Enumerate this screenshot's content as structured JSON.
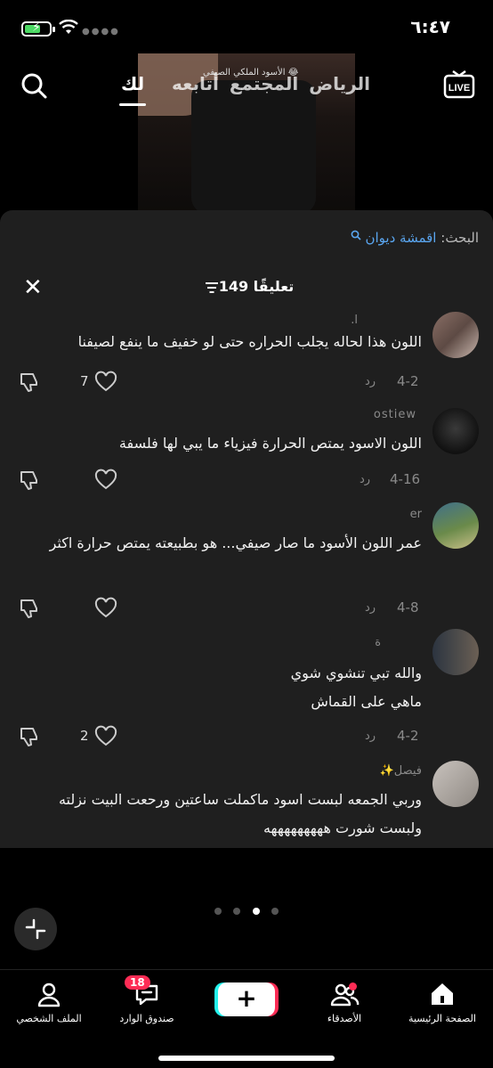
{
  "status_bar": {
    "time": "٦:٤٧"
  },
  "video": {
    "caption": "الأسود الملكي الصيفي 😂"
  },
  "top_nav": {
    "tabs": [
      "الرياض",
      "المجتمع",
      "أتابعه"
    ],
    "active_tab": "لك"
  },
  "sheet": {
    "search_label": "البحث:",
    "search_query": "اقمشة ديوان",
    "comment_count_title": "149 تعليقًا",
    "reply_label": "رد",
    "comments": [
      {
        "name": "ا.",
        "text": "اللون هذا لحاله يجلب الحراره حتى لو خفيف ما ينفع لصيفنا",
        "date": "4-2",
        "likes": "7"
      },
      {
        "name": "ostiew",
        "text": "اللون الاسود يمتص الحرارة فيزياء ما يبي لها فلسفة",
        "date": "4-16",
        "likes": ""
      },
      {
        "name": "er",
        "text": "عمر اللون الأسود ما صار صيفي... هو بطبيعته يمتص حرارة اكثر",
        "date": "4-8",
        "likes": ""
      },
      {
        "name": "ة",
        "text": "والله تبي تنشوي شوي\nماهي على القماش",
        "date": "4-2",
        "likes": "2"
      },
      {
        "name": "فيصل✨",
        "text": "وربي الجمعه لبست اسود ماكملت ساعتين ورحعت البيت نزلته ولبست شورت هههههههههه",
        "date": "",
        "likes": ""
      }
    ]
  },
  "bottom_nav": {
    "home": "الصفحة الرئيسية",
    "friends": "الأصدقاء",
    "inbox": "صندوق الوارد",
    "inbox_badge": "18",
    "profile": "الملف الشخصي"
  },
  "colors": {
    "accent": "#fe2c55",
    "link": "#5aa6f0",
    "sheet_bg": "#1f1f1f"
  }
}
